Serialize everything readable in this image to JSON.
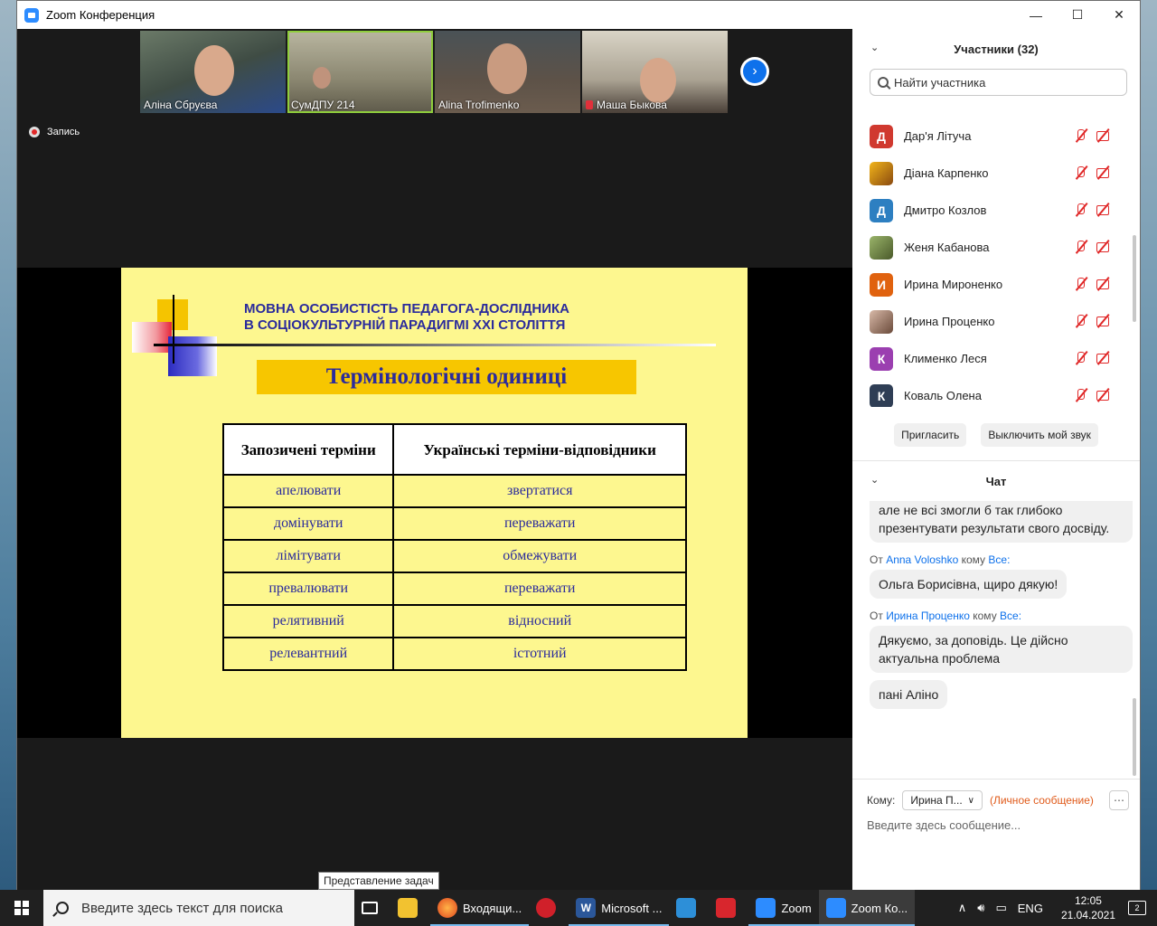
{
  "window": {
    "title": "Zoom Конференция"
  },
  "video": {
    "thumbnails": [
      {
        "name": "Аліна Сбруєва",
        "muted": false
      },
      {
        "name": "СумДПУ 214",
        "muted": false
      },
      {
        "name": "Alina Trofimenko",
        "muted": false
      },
      {
        "name": "Маша Быкова",
        "muted": true
      }
    ],
    "recording_label": "Запись"
  },
  "slide": {
    "header": "МОВНА ОСОБИСТІСТЬ ПЕДАГОГА-ДОСЛІДНИКА\nВ СОЦІОКУЛЬТУРНІЙ ПАРАДИГМІ ХХІ СТОЛІТТЯ",
    "banner": "Термінологічні одиниці",
    "columns": [
      "Запозичені терміни",
      "Українські терміни-відповідники"
    ],
    "rows": [
      [
        "апелювати",
        "звертатися"
      ],
      [
        "домінувати",
        "переважати"
      ],
      [
        "лімітувати",
        "обмежувати"
      ],
      [
        "превалювати",
        "переважати"
      ],
      [
        "релятивний",
        "відносний"
      ],
      [
        "релевантний",
        "істотний"
      ]
    ]
  },
  "participants": {
    "title": "Участники (32)",
    "search_placeholder": "Найти участника",
    "list": [
      {
        "initial": "Д",
        "name": "Дар'я Літуча",
        "color": "#d0392f"
      },
      {
        "initial": "",
        "name": "Діана Карпенко",
        "color": "#c98a1a"
      },
      {
        "initial": "Д",
        "name": "Дмитро Козлов",
        "color": "#2d7fc1"
      },
      {
        "initial": "",
        "name": "Женя Кабанова",
        "color": "#6a8a4a"
      },
      {
        "initial": "И",
        "name": "Ирина Мироненко",
        "color": "#e0620f"
      },
      {
        "initial": "",
        "name": "Ирина Проценко",
        "color": "#b58f7a"
      },
      {
        "initial": "К",
        "name": "Клименко Леся",
        "color": "#9b3fb0"
      },
      {
        "initial": "К",
        "name": "Коваль Олена",
        "color": "#2f3e55"
      }
    ],
    "invite_label": "Пригласить",
    "mute_label": "Выключить мой звук"
  },
  "chat": {
    "title": "Чат",
    "messages": [
      {
        "from": "",
        "to": "",
        "text": "але не всі змогли б так глибоко презентувати результати свого досвіду."
      },
      {
        "from": "Anna Voloshko",
        "to": "Все:",
        "text": "Ольга Борисівна, щиро дякую!"
      },
      {
        "from": "Ирина Проценко",
        "to": "Все:",
        "text": "Дякуємо, за доповідь. Це дійсно актуальна проблема"
      },
      {
        "from": "",
        "to": "",
        "text": "пані Аліно"
      }
    ],
    "from_word": "От",
    "to_word": "кому",
    "recipient_label": "Кому:",
    "recipient_value": "Ирина П...",
    "private_label": "(Личное сообщение)",
    "input_placeholder": "Введите здесь сообщение..."
  },
  "tooltip": "Представление задач",
  "taskbar": {
    "search_placeholder": "Введите здесь текст для поиска",
    "apps": [
      {
        "label": "Входящи...",
        "icon": "firefox-icon"
      },
      {
        "label": "Microsoft ...",
        "icon": "word-icon"
      },
      {
        "label": "Zoom",
        "icon": "zoom-icon"
      },
      {
        "label": "Zoom Ко...",
        "icon": "zoom-icon"
      }
    ],
    "lang": "ENG",
    "time": "12:05",
    "date": "21.04.2021",
    "notif_count": "2"
  }
}
